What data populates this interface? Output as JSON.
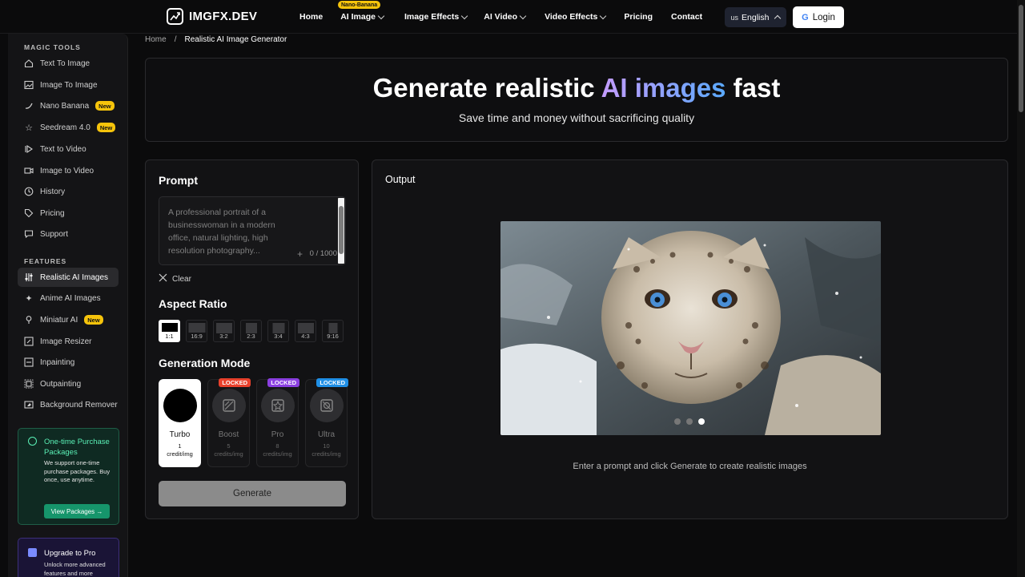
{
  "brand": {
    "name": "IMGFX.DEV"
  },
  "nav": {
    "items": [
      {
        "label": "Home",
        "dropdown": false
      },
      {
        "label": "AI Image",
        "dropdown": true,
        "badge": "Nano-Banana"
      },
      {
        "label": "Image Effects",
        "dropdown": true
      },
      {
        "label": "AI Video",
        "dropdown": true
      },
      {
        "label": "Video Effects",
        "dropdown": true
      },
      {
        "label": "Pricing",
        "dropdown": false
      },
      {
        "label": "Contact",
        "dropdown": false
      }
    ],
    "language": {
      "flag": "us",
      "label": "English"
    },
    "login_label": "Login"
  },
  "sidebar": {
    "magic_title": "MAGIC TOOLS",
    "magic_items": [
      {
        "label": "Text To Image",
        "icon": "home-icon"
      },
      {
        "label": "Image To Image",
        "icon": "image-icon"
      },
      {
        "label": "Nano Banana",
        "icon": "banana-icon",
        "badge": "New"
      },
      {
        "label": "Seedream 4.0",
        "icon": "star-icon",
        "badge": "New"
      },
      {
        "label": "Text to Video",
        "icon": "video-play-icon"
      },
      {
        "label": "Image to Video",
        "icon": "video-icon"
      },
      {
        "label": "History",
        "icon": "clock-icon"
      },
      {
        "label": "Pricing",
        "icon": "tag-icon"
      },
      {
        "label": "Support",
        "icon": "chat-icon"
      }
    ],
    "features_title": "FEATURES",
    "feature_items": [
      {
        "label": "Realistic AI Images",
        "icon": "sliders-icon",
        "active": true
      },
      {
        "label": "Anime AI Images",
        "icon": "sparkle-icon"
      },
      {
        "label": "Miniatur AI",
        "icon": "pin-icon",
        "badge": "New"
      },
      {
        "label": "Image Resizer",
        "icon": "resize-icon"
      },
      {
        "label": "Inpainting",
        "icon": "brush-icon"
      },
      {
        "label": "Outpainting",
        "icon": "expand-icon"
      },
      {
        "label": "Background Remover",
        "icon": "eraser-icon"
      }
    ],
    "promo_purchase": {
      "title": "One-time Purchase Packages",
      "desc": "We support one-time purchase packages. Buy once, use anytime.",
      "button": "View Packages →"
    },
    "promo_upgrade": {
      "title": "Upgrade to Pro",
      "desc": "Unlock more advanced features and more"
    }
  },
  "breadcrumb": {
    "home": "Home",
    "sep": "/",
    "current": "Realistic AI Image Generator"
  },
  "hero": {
    "title_start": "Generate realistic ",
    "title_highlight": "AI images",
    "title_end": " fast",
    "subtitle": "Save time and money without sacrificing quality"
  },
  "prompt": {
    "heading": "Prompt",
    "placeholder": "A professional portrait of a businesswoman in a modern office, natural lighting, high resolution photography...",
    "counter": "0 / 1000",
    "clear_label": "Clear"
  },
  "aspect": {
    "heading": "Aspect Ratio",
    "options": [
      "1:1",
      "16:9",
      "3:2",
      "2:3",
      "3:4",
      "4:3",
      "9:16"
    ],
    "selected": "1:1"
  },
  "mode": {
    "heading": "Generation Mode",
    "options": [
      {
        "name": "Turbo",
        "credits": "1",
        "unit": "credit/img",
        "locked": false
      },
      {
        "name": "Boost",
        "credits": "5",
        "unit": "credits/img",
        "locked": true,
        "lock_label": "LOCKED",
        "lock_color": "#e8412c"
      },
      {
        "name": "Pro",
        "credits": "8",
        "unit": "credits/img",
        "locked": true,
        "lock_label": "LOCKED",
        "lock_color": "#8b3fe0"
      },
      {
        "name": "Ultra",
        "credits": "10",
        "unit": "credits/img",
        "locked": true,
        "lock_label": "LOCKED",
        "lock_color": "#1f8fe6"
      }
    ]
  },
  "generate_label": "Generate",
  "output": {
    "heading": "Output",
    "hint": "Enter a prompt and click Generate to create realistic images",
    "carousel_index": 3,
    "carousel_count": 3
  },
  "colors": {
    "accent_purple": "#c49cff",
    "accent_blue": "#5aa9ff",
    "badge_yellow": "#f6c40b",
    "promo_green": "#5af0b6"
  }
}
